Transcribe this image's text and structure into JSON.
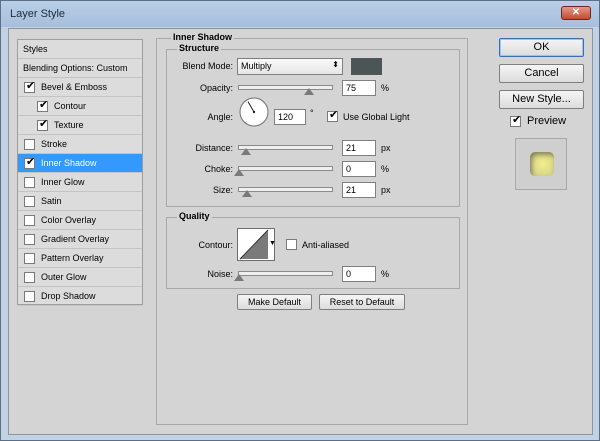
{
  "window": {
    "title": "Layer Style",
    "close_glyph": "✕"
  },
  "sidebar": {
    "items": [
      {
        "label": "Styles",
        "has_checkbox": false,
        "checked": false,
        "indent": 0,
        "selected": false
      },
      {
        "label": "Blending Options: Custom",
        "has_checkbox": false,
        "checked": false,
        "indent": 0,
        "selected": false
      },
      {
        "label": "Bevel & Emboss",
        "has_checkbox": true,
        "checked": true,
        "indent": 0,
        "selected": false
      },
      {
        "label": "Contour",
        "has_checkbox": true,
        "checked": true,
        "indent": 1,
        "selected": false
      },
      {
        "label": "Texture",
        "has_checkbox": true,
        "checked": true,
        "indent": 1,
        "selected": false
      },
      {
        "label": "Stroke",
        "has_checkbox": true,
        "checked": false,
        "indent": 0,
        "selected": false
      },
      {
        "label": "Inner Shadow",
        "has_checkbox": true,
        "checked": true,
        "indent": 0,
        "selected": true
      },
      {
        "label": "Inner Glow",
        "has_checkbox": true,
        "checked": false,
        "indent": 0,
        "selected": false
      },
      {
        "label": "Satin",
        "has_checkbox": true,
        "checked": false,
        "indent": 0,
        "selected": false
      },
      {
        "label": "Color Overlay",
        "has_checkbox": true,
        "checked": false,
        "indent": 0,
        "selected": false
      },
      {
        "label": "Gradient Overlay",
        "has_checkbox": true,
        "checked": false,
        "indent": 0,
        "selected": false
      },
      {
        "label": "Pattern Overlay",
        "has_checkbox": true,
        "checked": false,
        "indent": 0,
        "selected": false
      },
      {
        "label": "Outer Glow",
        "has_checkbox": true,
        "checked": false,
        "indent": 0,
        "selected": false
      },
      {
        "label": "Drop Shadow",
        "has_checkbox": true,
        "checked": false,
        "indent": 0,
        "selected": false
      }
    ]
  },
  "inner_shadow": {
    "title": "Inner Shadow",
    "structure": {
      "title": "Structure",
      "blend_mode_label": "Blend Mode:",
      "blend_mode_value": "Multiply",
      "shadow_color": "#4b5553",
      "opacity_label": "Opacity:",
      "opacity_value": "75",
      "opacity_fraction": 0.75,
      "opacity_unit": "%",
      "angle_label": "Angle:",
      "angle_value": "120",
      "angle_degrees": 120,
      "angle_unit": "°",
      "global_light_label": "Use Global Light",
      "global_light_checked": true,
      "distance_label": "Distance:",
      "distance_value": "21",
      "distance_fraction": 0.07,
      "distance_unit": "px",
      "choke_label": "Choke:",
      "choke_value": "0",
      "choke_fraction": 0,
      "choke_unit": "%",
      "size_label": "Size:",
      "size_value": "21",
      "size_fraction": 0.085,
      "size_unit": "px"
    },
    "quality": {
      "title": "Quality",
      "contour_label": "Contour:",
      "anti_aliased_label": "Anti-aliased",
      "anti_aliased_checked": false,
      "noise_label": "Noise:",
      "noise_value": "0",
      "noise_fraction": 0,
      "noise_unit": "%"
    },
    "make_default_label": "Make Default",
    "reset_default_label": "Reset to Default"
  },
  "actions": {
    "ok_label": "OK",
    "cancel_label": "Cancel",
    "new_style_label": "New Style...",
    "preview_label": "Preview",
    "preview_checked": true
  },
  "colors": {
    "selection": "#3399ff",
    "preview_glow": "#f2f08a"
  }
}
